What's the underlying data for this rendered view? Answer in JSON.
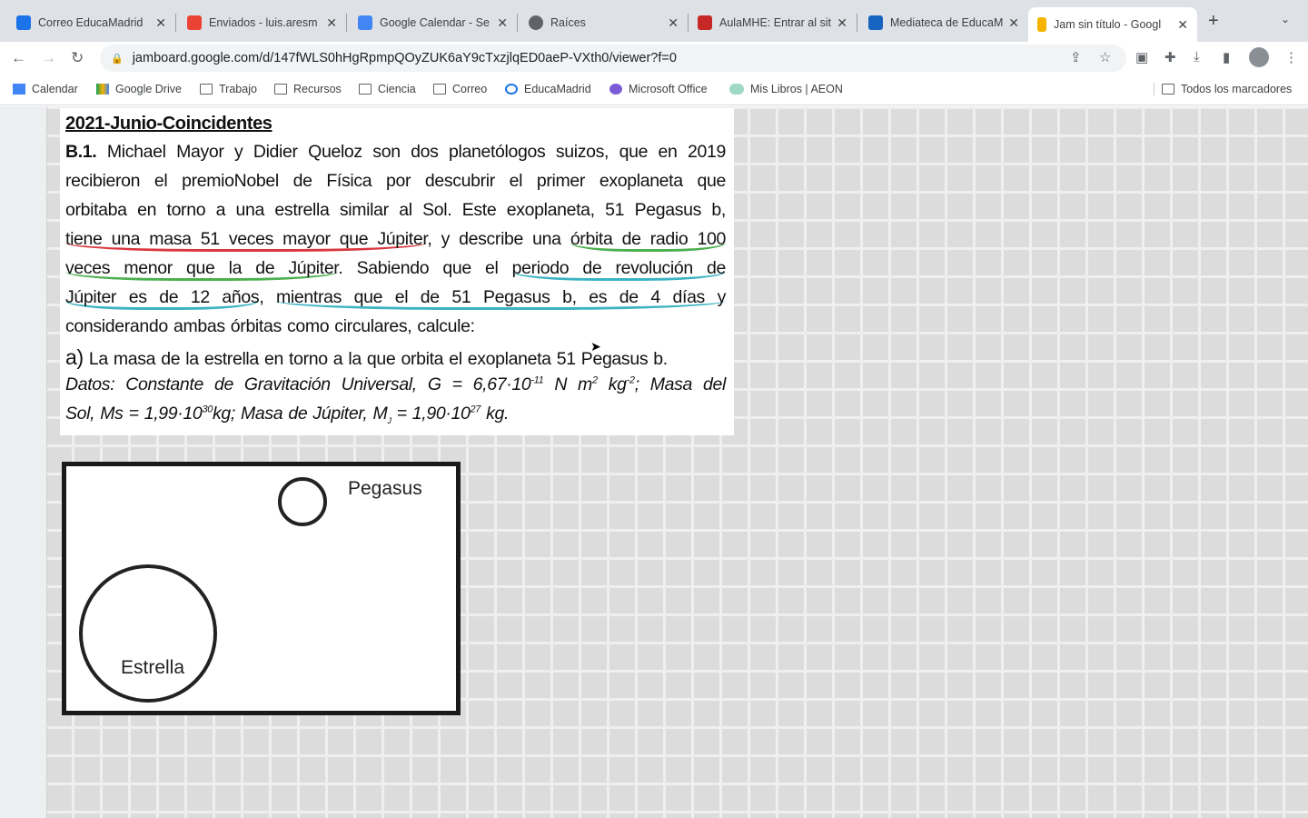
{
  "browser": {
    "tabs": [
      {
        "title": "Correo EducaMadrid",
        "icon": "mail-icon",
        "color": "#1a73e8"
      },
      {
        "title": "Enviados - luis.aresm",
        "icon": "gmail-icon",
        "color": "#ea4335"
      },
      {
        "title": "Google Calendar - Se",
        "icon": "calendar-icon",
        "color": "#4285f4"
      },
      {
        "title": "Raíces",
        "icon": "globe-icon",
        "color": "#5f6368"
      },
      {
        "title": "AulaMHE: Entrar al sit",
        "icon": "aula-icon",
        "color": "#c62828"
      },
      {
        "title": "Mediateca de EducaM",
        "icon": "clapper-icon",
        "color": "#1565c0"
      },
      {
        "title": "Jam sin título - Googl",
        "icon": "jamboard-icon",
        "color": "#f4b400",
        "active": true
      }
    ],
    "url": "jamboard.google.com/d/147fWLS0hHgRpmpQOyZUK6aY9cTxzjlqED0aeP-VXth0/viewer?f=0",
    "bookmarks": [
      "Calendar",
      "Google Drive",
      "Trabajo",
      "Recursos",
      "Ciencia",
      "Correo",
      "EducaMadrid",
      "Microsoft Office",
      "Mis Libros | AEON"
    ],
    "all_bookmarks": "Todos los marcadores"
  },
  "card": {
    "title": "2021-Junio-Coincidentes",
    "b1": "B.1.",
    "l1": " Michael Mayor y Didier Queloz son dos planetólogos suizos, que en 2019",
    "l2": "recibieron el premioNobel de Física por descubrir el primer exoplaneta que",
    "l3": "orbitaba en torno a una estrella similar al Sol. Este exoplaneta, 51 Pegasus b,",
    "l4a": "tiene una masa 51 veces mayor que Júpiter",
    "l4b": ", y describe una ",
    "l4c": "órbita de radio 100",
    "l5a": "veces menor que la de Júpiter",
    "l5b": ". Sabiendo que el ",
    "l5c": "periodo de revolución de",
    "l6a": "Júpiter es de 12 años",
    "l6b": ", ",
    "l6c": "mientras que el de 51 Pegasus b, es de 4 días y",
    "l7": "considerando ambas órbitas como circulares, calcule:",
    "qa_letter": "a)",
    "qa": " La masa de la estrella en torno a la que orbita el exoplaneta 51 Pegasus b.",
    "d1": "Datos: Constante de Gravitación Universal, G = 6,67·10",
    "d1e": "-11",
    "d1b": " N m",
    "d1e2": "2",
    "d1c": " kg",
    "d1e3": "-2",
    "d1d": "; Masa del",
    "d2": "Sol, Ms = 1,99·10",
    "d2e": "30",
    "d2b": "kg; Masa de Júpiter, M",
    "d2s": "J",
    "d2c": " = 1,90·10",
    "d2e2": "27",
    "d2d": " kg.",
    "colors": {
      "red": "#d9363e",
      "green": "#4caf50",
      "blue": "#3bb3c3"
    }
  },
  "diagram": {
    "planet_label": "Pegasus",
    "star_label": "Estrella"
  }
}
